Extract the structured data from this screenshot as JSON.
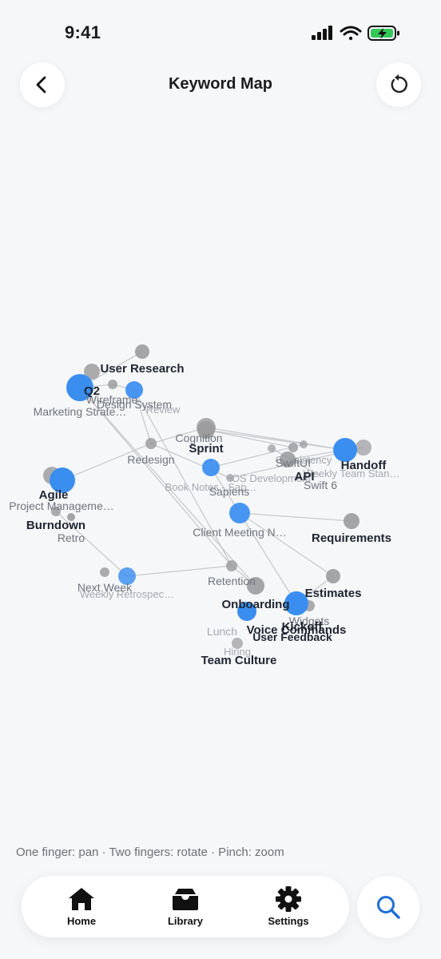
{
  "status_bar": {
    "time": "9:41",
    "icons": [
      "cellular-signal-icon",
      "wifi-icon",
      "battery-charging-icon"
    ],
    "battery_color": "#34c759"
  },
  "header": {
    "title": "Keyword Map",
    "back_icon": "chevron-left-icon",
    "refresh_icon": "rotate-ccw-icon"
  },
  "graph": {
    "colors": {
      "highlight": "#3a8ef0",
      "neutral": "#9b9b9f",
      "edge": "#c8cacd"
    },
    "nodes": [
      {
        "id": "user-research",
        "label": "User Research",
        "style": "front",
        "kind": "gray"
      },
      {
        "id": "q2",
        "label": "Q2",
        "style": "front",
        "kind": "blue"
      },
      {
        "id": "wireframe",
        "label": "Wireframe",
        "style": "mid",
        "kind": "gray"
      },
      {
        "id": "design-system",
        "label": "Design System",
        "style": "mid",
        "kind": "blue"
      },
      {
        "id": "review",
        "label": "Review",
        "style": "back",
        "kind": "gray"
      },
      {
        "id": "marketing-strategy",
        "label": "Marketing Strate…",
        "style": "mid",
        "kind": "gray"
      },
      {
        "id": "cognition",
        "label": "Cognition",
        "style": "mid",
        "kind": "gray"
      },
      {
        "id": "sprint",
        "label": "Sprint",
        "style": "front",
        "kind": "gray"
      },
      {
        "id": "redesign",
        "label": "Redesign",
        "style": "mid",
        "kind": "gray"
      },
      {
        "id": "swiftui",
        "label": "SwiftUI",
        "style": "mid",
        "kind": "gray"
      },
      {
        "id": "handoff",
        "label": "Handoff",
        "style": "front",
        "kind": "blue"
      },
      {
        "id": "consistency",
        "label": "Consistency",
        "style": "back",
        "kind": "gray"
      },
      {
        "id": "weekly-team-standup",
        "label": "Weekly Team Stan…",
        "style": "back",
        "kind": "gray"
      },
      {
        "id": "ios-development",
        "label": "iOS Development",
        "style": "back",
        "kind": "gray"
      },
      {
        "id": "api",
        "label": "API",
        "style": "front",
        "kind": "gray"
      },
      {
        "id": "swift-6",
        "label": "Swift 6",
        "style": "mid",
        "kind": "gray"
      },
      {
        "id": "book-notes",
        "label": "Book Notes - Sap…",
        "style": "back",
        "kind": "gray"
      },
      {
        "id": "sapiens",
        "label": "Sapiens",
        "style": "mid",
        "kind": "blue"
      },
      {
        "id": "agile",
        "label": "Agile",
        "style": "front",
        "kind": "blue"
      },
      {
        "id": "project-management",
        "label": "Project Manageme…",
        "style": "mid",
        "kind": "gray"
      },
      {
        "id": "burndown",
        "label": "Burndown",
        "style": "front",
        "kind": "gray"
      },
      {
        "id": "retro",
        "label": "Retro",
        "style": "mid",
        "kind": "gray"
      },
      {
        "id": "client-meeting-notes",
        "label": "Client Meeting N…",
        "style": "mid",
        "kind": "blue"
      },
      {
        "id": "requirements",
        "label": "Requirements",
        "style": "front",
        "kind": "gray"
      },
      {
        "id": "next-week",
        "label": "Next Week",
        "style": "mid",
        "kind": "gray"
      },
      {
        "id": "weekly-retrospective",
        "label": "Weekly Retrospec…",
        "style": "back",
        "kind": "blue"
      },
      {
        "id": "retention",
        "label": "Retention",
        "style": "mid",
        "kind": "gray"
      },
      {
        "id": "estimates",
        "label": "Estimates",
        "style": "front",
        "kind": "gray"
      },
      {
        "id": "onboarding",
        "label": "Onboarding",
        "style": "front",
        "kind": "gray"
      },
      {
        "id": "widgets",
        "label": "Widgets",
        "style": "mid",
        "kind": "gray"
      },
      {
        "id": "voice-commands",
        "label": "Voice Commands",
        "style": "front",
        "kind": "blue"
      },
      {
        "id": "kickoff",
        "label": "Kickoff",
        "style": "front",
        "kind": "blue"
      },
      {
        "id": "lunch",
        "label": "Lunch",
        "style": "back",
        "kind": "gray"
      },
      {
        "id": "user-feedback",
        "label": "User Feedback",
        "style": "front",
        "kind": "gray"
      },
      {
        "id": "hiring",
        "label": "Hiring",
        "style": "back",
        "kind": "gray"
      },
      {
        "id": "team-culture",
        "label": "Team Culture",
        "style": "front",
        "kind": "gray"
      }
    ]
  },
  "hint": "One finger: pan · Two fingers: rotate · Pinch: zoom",
  "tab_bar": {
    "home": {
      "label": "Home",
      "icon": "house-icon"
    },
    "library": {
      "label": "Library",
      "icon": "tray-icon"
    },
    "settings": {
      "label": "Settings",
      "icon": "gear-icon"
    }
  },
  "search": {
    "icon": "magnifying-glass-icon",
    "color": "#1f6fd6"
  }
}
